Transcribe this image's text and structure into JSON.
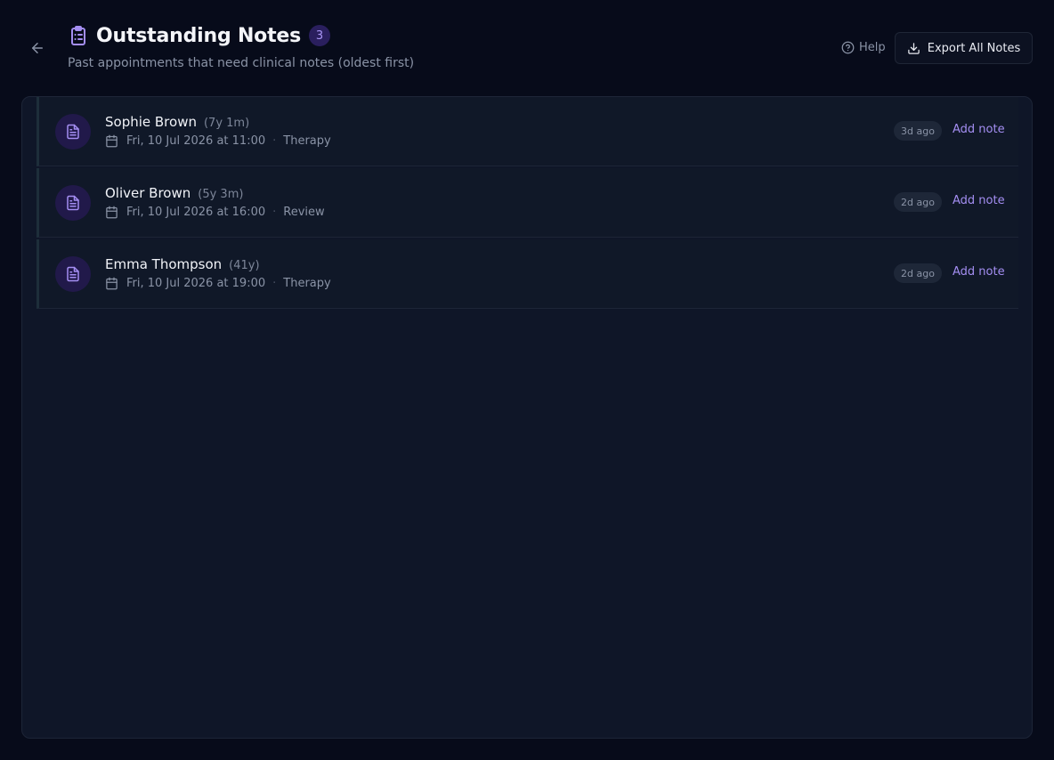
{
  "header": {
    "title": "Outstanding Notes",
    "count": "3",
    "subtitle": "Past appointments that need clinical notes (oldest first)",
    "help_label": "Help",
    "export_label": "Export All Notes",
    "icons": {
      "back": "arrow-left-icon",
      "title": "clipboard-list-icon",
      "help": "help-circle-icon",
      "export": "download-icon"
    }
  },
  "appointments": [
    {
      "name": "Sophie Brown",
      "age": "(7y 1m)",
      "datetime": "Fri, 10 Jul 2026 at 11:00",
      "type": "Therapy",
      "ago": "3d ago",
      "action": "Add note"
    },
    {
      "name": "Oliver Brown",
      "age": "(5y 3m)",
      "datetime": "Fri, 10 Jul 2026 at 16:00",
      "type": "Review",
      "ago": "2d ago",
      "action": "Add note"
    },
    {
      "name": "Emma Thompson",
      "age": "(41y)",
      "datetime": "Fri, 10 Jul 2026 at 19:00",
      "type": "Therapy",
      "ago": "2d ago",
      "action": "Add note"
    }
  ],
  "separator": "·",
  "colors": {
    "background": "#070b1a",
    "panel": "#0f1628",
    "accent": "#a48ef2",
    "badge_bg": "#2a1f5e"
  }
}
